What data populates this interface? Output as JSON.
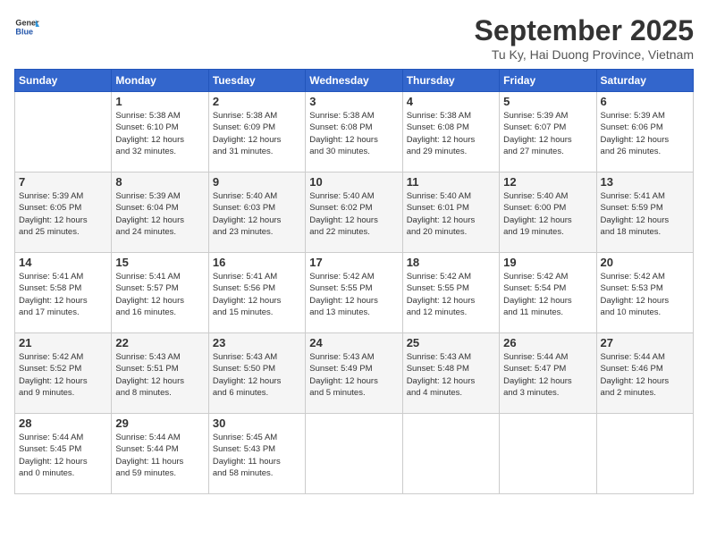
{
  "header": {
    "logo_general": "General",
    "logo_blue": "Blue",
    "title": "September 2025",
    "subtitle": "Tu Ky, Hai Duong Province, Vietnam"
  },
  "days_of_week": [
    "Sunday",
    "Monday",
    "Tuesday",
    "Wednesday",
    "Thursday",
    "Friday",
    "Saturday"
  ],
  "weeks": [
    [
      {
        "day": "",
        "info": ""
      },
      {
        "day": "1",
        "info": "Sunrise: 5:38 AM\nSunset: 6:10 PM\nDaylight: 12 hours\nand 32 minutes."
      },
      {
        "day": "2",
        "info": "Sunrise: 5:38 AM\nSunset: 6:09 PM\nDaylight: 12 hours\nand 31 minutes."
      },
      {
        "day": "3",
        "info": "Sunrise: 5:38 AM\nSunset: 6:08 PM\nDaylight: 12 hours\nand 30 minutes."
      },
      {
        "day": "4",
        "info": "Sunrise: 5:38 AM\nSunset: 6:08 PM\nDaylight: 12 hours\nand 29 minutes."
      },
      {
        "day": "5",
        "info": "Sunrise: 5:39 AM\nSunset: 6:07 PM\nDaylight: 12 hours\nand 27 minutes."
      },
      {
        "day": "6",
        "info": "Sunrise: 5:39 AM\nSunset: 6:06 PM\nDaylight: 12 hours\nand 26 minutes."
      }
    ],
    [
      {
        "day": "7",
        "info": "Sunrise: 5:39 AM\nSunset: 6:05 PM\nDaylight: 12 hours\nand 25 minutes."
      },
      {
        "day": "8",
        "info": "Sunrise: 5:39 AM\nSunset: 6:04 PM\nDaylight: 12 hours\nand 24 minutes."
      },
      {
        "day": "9",
        "info": "Sunrise: 5:40 AM\nSunset: 6:03 PM\nDaylight: 12 hours\nand 23 minutes."
      },
      {
        "day": "10",
        "info": "Sunrise: 5:40 AM\nSunset: 6:02 PM\nDaylight: 12 hours\nand 22 minutes."
      },
      {
        "day": "11",
        "info": "Sunrise: 5:40 AM\nSunset: 6:01 PM\nDaylight: 12 hours\nand 20 minutes."
      },
      {
        "day": "12",
        "info": "Sunrise: 5:40 AM\nSunset: 6:00 PM\nDaylight: 12 hours\nand 19 minutes."
      },
      {
        "day": "13",
        "info": "Sunrise: 5:41 AM\nSunset: 5:59 PM\nDaylight: 12 hours\nand 18 minutes."
      }
    ],
    [
      {
        "day": "14",
        "info": "Sunrise: 5:41 AM\nSunset: 5:58 PM\nDaylight: 12 hours\nand 17 minutes."
      },
      {
        "day": "15",
        "info": "Sunrise: 5:41 AM\nSunset: 5:57 PM\nDaylight: 12 hours\nand 16 minutes."
      },
      {
        "day": "16",
        "info": "Sunrise: 5:41 AM\nSunset: 5:56 PM\nDaylight: 12 hours\nand 15 minutes."
      },
      {
        "day": "17",
        "info": "Sunrise: 5:42 AM\nSunset: 5:55 PM\nDaylight: 12 hours\nand 13 minutes."
      },
      {
        "day": "18",
        "info": "Sunrise: 5:42 AM\nSunset: 5:55 PM\nDaylight: 12 hours\nand 12 minutes."
      },
      {
        "day": "19",
        "info": "Sunrise: 5:42 AM\nSunset: 5:54 PM\nDaylight: 12 hours\nand 11 minutes."
      },
      {
        "day": "20",
        "info": "Sunrise: 5:42 AM\nSunset: 5:53 PM\nDaylight: 12 hours\nand 10 minutes."
      }
    ],
    [
      {
        "day": "21",
        "info": "Sunrise: 5:42 AM\nSunset: 5:52 PM\nDaylight: 12 hours\nand 9 minutes."
      },
      {
        "day": "22",
        "info": "Sunrise: 5:43 AM\nSunset: 5:51 PM\nDaylight: 12 hours\nand 8 minutes."
      },
      {
        "day": "23",
        "info": "Sunrise: 5:43 AM\nSunset: 5:50 PM\nDaylight: 12 hours\nand 6 minutes."
      },
      {
        "day": "24",
        "info": "Sunrise: 5:43 AM\nSunset: 5:49 PM\nDaylight: 12 hours\nand 5 minutes."
      },
      {
        "day": "25",
        "info": "Sunrise: 5:43 AM\nSunset: 5:48 PM\nDaylight: 12 hours\nand 4 minutes."
      },
      {
        "day": "26",
        "info": "Sunrise: 5:44 AM\nSunset: 5:47 PM\nDaylight: 12 hours\nand 3 minutes."
      },
      {
        "day": "27",
        "info": "Sunrise: 5:44 AM\nSunset: 5:46 PM\nDaylight: 12 hours\nand 2 minutes."
      }
    ],
    [
      {
        "day": "28",
        "info": "Sunrise: 5:44 AM\nSunset: 5:45 PM\nDaylight: 12 hours\nand 0 minutes."
      },
      {
        "day": "29",
        "info": "Sunrise: 5:44 AM\nSunset: 5:44 PM\nDaylight: 11 hours\nand 59 minutes."
      },
      {
        "day": "30",
        "info": "Sunrise: 5:45 AM\nSunset: 5:43 PM\nDaylight: 11 hours\nand 58 minutes."
      },
      {
        "day": "",
        "info": ""
      },
      {
        "day": "",
        "info": ""
      },
      {
        "day": "",
        "info": ""
      },
      {
        "day": "",
        "info": ""
      }
    ]
  ]
}
